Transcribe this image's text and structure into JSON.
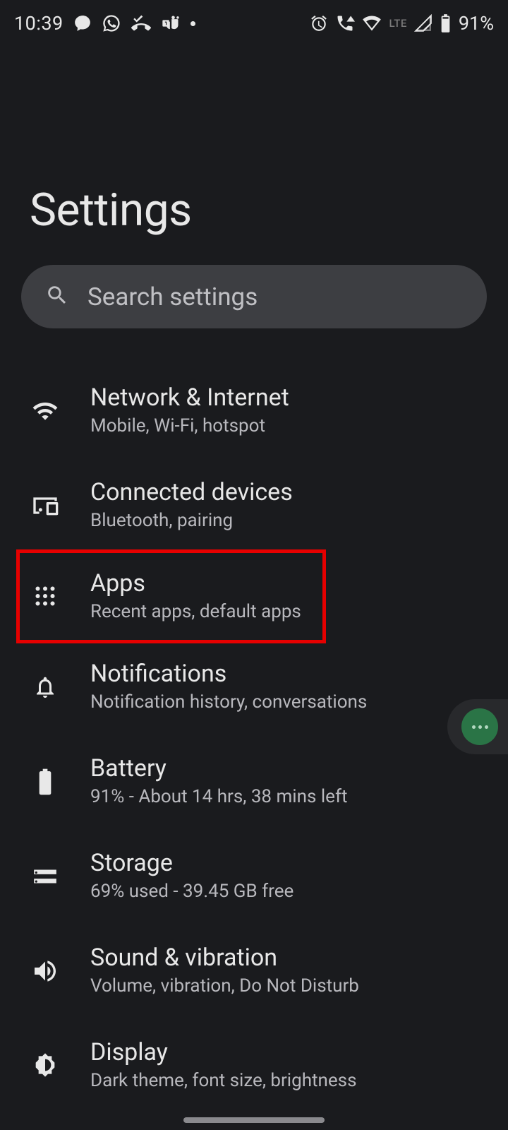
{
  "status": {
    "time": "10:39",
    "lte": "LTE",
    "battery": "91%"
  },
  "header": {
    "title": "Settings"
  },
  "search": {
    "placeholder": "Search settings"
  },
  "items": [
    {
      "title": "Network & Internet",
      "subtitle": "Mobile, Wi-Fi, hotspot"
    },
    {
      "title": "Connected devices",
      "subtitle": "Bluetooth, pairing"
    },
    {
      "title": "Apps",
      "subtitle": "Recent apps, default apps"
    },
    {
      "title": "Notifications",
      "subtitle": "Notification history, conversations"
    },
    {
      "title": "Battery",
      "subtitle": "91% - About 14 hrs, 38 mins left"
    },
    {
      "title": "Storage",
      "subtitle": "69% used - 39.45 GB free"
    },
    {
      "title": "Sound & vibration",
      "subtitle": "Volume, vibration, Do Not Disturb"
    },
    {
      "title": "Display",
      "subtitle": "Dark theme, font size, brightness"
    }
  ]
}
